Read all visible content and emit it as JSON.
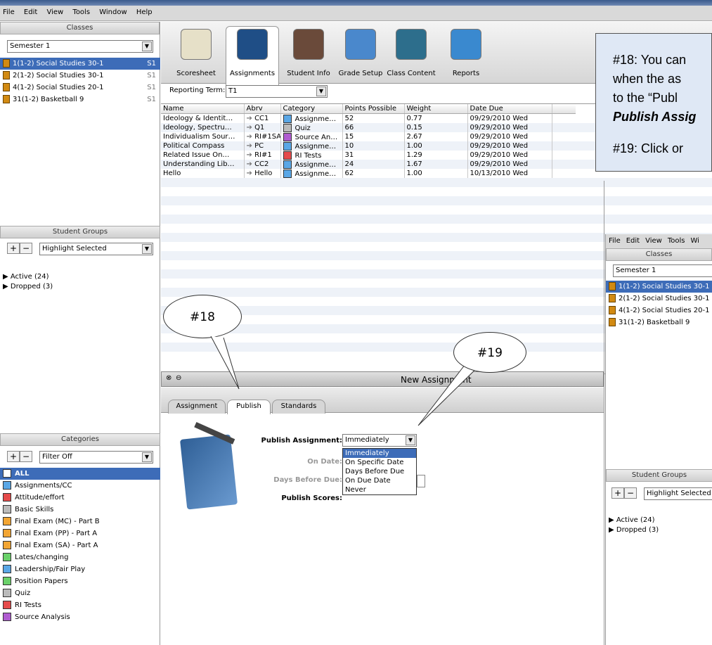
{
  "menu": [
    "File",
    "Edit",
    "View",
    "Tools",
    "Window",
    "Help"
  ],
  "classes_panel": {
    "title": "Classes",
    "term": "Semester 1",
    "items": [
      {
        "label": "1(1-2) Social Studies 30-1",
        "term": "S1"
      },
      {
        "label": "2(1-2) Social Studies 30-1",
        "term": "S1"
      },
      {
        "label": "4(1-2) Social Studies 20-1",
        "term": "S1"
      },
      {
        "label": "31(1-2) Basketball 9",
        "term": "S1"
      }
    ]
  },
  "student_groups": {
    "title": "Student Groups",
    "filter": "Highlight Selected",
    "items": [
      "Active (24)",
      "Dropped (3)"
    ]
  },
  "categories_panel": {
    "title": "Categories",
    "filter": "Filter Off",
    "items": [
      {
        "label": "ALL",
        "color": "#ffffff"
      },
      {
        "label": "Assignments/CC",
        "color": "#5aa7e6"
      },
      {
        "label": "Attitude/effort",
        "color": "#e54b4b"
      },
      {
        "label": "Basic Skills",
        "color": "#bbbbbb"
      },
      {
        "label": "Final Exam (MC) - Part B",
        "color": "#f2a533"
      },
      {
        "label": "Final Exam (PP) - Part A",
        "color": "#f2a533"
      },
      {
        "label": "Final Exam (SA) - Part A",
        "color": "#f2a533"
      },
      {
        "label": "Lates/changing",
        "color": "#6ad16a"
      },
      {
        "label": "Leadership/Fair Play",
        "color": "#5aa7e6"
      },
      {
        "label": "Position Papers",
        "color": "#6ad16a"
      },
      {
        "label": "Quiz",
        "color": "#bbbbbb"
      },
      {
        "label": "RI Tests",
        "color": "#e54b4b"
      },
      {
        "label": "Source Analysis",
        "color": "#b05cd1"
      }
    ]
  },
  "toolbar_tabs": [
    "Scoresheet",
    "Assignments",
    "Student Info",
    "Grade Setup",
    "Class Content",
    "Reports"
  ],
  "reporting_term_label": "Reporting Term:",
  "reporting_term_value": "T1",
  "grid": {
    "headers": [
      "Name",
      "Abrv",
      "Category",
      "Points Possible",
      "Weight",
      "Date Due"
    ],
    "rows": [
      [
        "Ideology & Identit…",
        "CC1",
        "Assignme…",
        "52",
        "0.77",
        "09/29/2010 Wed"
      ],
      [
        "Ideology, Spectru…",
        "Q1",
        "Quiz",
        "66",
        "0.15",
        "09/29/2010 Wed"
      ],
      [
        "Individualism Sour…",
        "RI#1SA",
        "Source An…",
        "15",
        "2.67",
        "09/29/2010 Wed"
      ],
      [
        "Political Compass",
        "PC",
        "Assignme…",
        "10",
        "1.00",
        "09/29/2010 Wed"
      ],
      [
        "Related Issue On…",
        "RI#1",
        "RI Tests",
        "31",
        "1.29",
        "09/29/2010 Wed"
      ],
      [
        "Understanding Lib…",
        "CC2",
        "Assignme…",
        "24",
        "1.67",
        "09/29/2010 Wed"
      ],
      [
        "Hello",
        "Hello",
        "Assignme…",
        "62",
        "1.00",
        "10/13/2010 Wed"
      ]
    ],
    "row_category_colors": [
      "#5aa7e6",
      "#bbbbbb",
      "#b05cd1",
      "#5aa7e6",
      "#e54b4b",
      "#5aa7e6",
      "#5aa7e6"
    ]
  },
  "new_assignment": {
    "title": "New Assignment",
    "tabs": [
      "Assignment",
      "Publish",
      "Standards"
    ],
    "publish_assignment_label": "Publish Assignment:",
    "publish_assignment_value": "Immediately",
    "on_date_label": "On Date:",
    "days_before_label": "Days Before Due:",
    "publish_scores_label": "Publish Scores:",
    "dropdown_options": [
      "Immediately",
      "On Specific Date",
      "Days Before Due",
      "On Due Date",
      "Never"
    ]
  },
  "callouts": {
    "bubble18": "#18",
    "bubble19": "#19",
    "text_lines": [
      "#18: You can",
      "when the as",
      "to the “Publ",
      "Publish Assig"
    ],
    "text19": "#19: Click or"
  },
  "inset": {
    "menu": [
      "File",
      "Edit",
      "View",
      "Tools",
      "Wi"
    ],
    "classes_title": "Classes",
    "term": "Semester 1",
    "items": [
      "1(1-2) Social Studies 30-1",
      "2(1-2) Social Studies 30-1",
      "4(1-2) Social Studies 20-1",
      "31(1-2) Basketball 9"
    ],
    "groups_title": "Student Groups",
    "groups_filter": "Highlight Selected",
    "groups": [
      "Active (24)",
      "Dropped (3)"
    ]
  }
}
